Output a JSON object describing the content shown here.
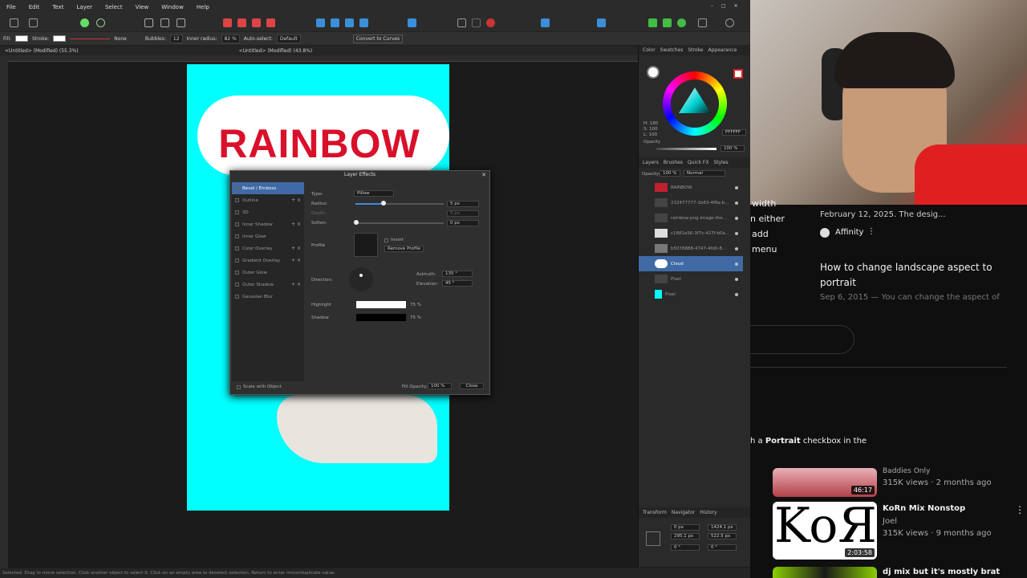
{
  "menu": [
    "File",
    "Edit",
    "Text",
    "Layer",
    "Select",
    "View",
    "Window",
    "Help"
  ],
  "context": {
    "fill_label": "Fill:",
    "stroke_label": "Stroke:",
    "stroke_value": "None",
    "bubbles_label": "Bubbles:",
    "bubbles_value": "12",
    "inner_radius_label": "Inner radius:",
    "inner_radius_value": "82 %",
    "auto_select_label": "Auto-select:",
    "auto_select_value": "Default",
    "convert_label": "Convert to Curves"
  },
  "doc_tabs": [
    "<Untitled> (Modified) (55.3%)",
    "<Untitled> (Modified) (43.8%)"
  ],
  "canvas": {
    "title_text": "RAINBOW"
  },
  "dialog": {
    "title": "Layer Effects",
    "effects": [
      {
        "label": "Bevel / Emboss",
        "selected": true,
        "controls": ""
      },
      {
        "label": "Outline",
        "selected": false,
        "controls": "+ ×"
      },
      {
        "label": "3D",
        "selected": false,
        "controls": ""
      },
      {
        "label": "Inner Shadow",
        "selected": false,
        "controls": "+ ×"
      },
      {
        "label": "Inner Glow",
        "selected": false,
        "controls": ""
      },
      {
        "label": "Color Overlay",
        "selected": false,
        "controls": "+ ×"
      },
      {
        "label": "Gradient Overlay",
        "selected": false,
        "controls": "+ ×"
      },
      {
        "label": "Outer Glow",
        "selected": false,
        "controls": ""
      },
      {
        "label": "Outer Shadow",
        "selected": false,
        "controls": "+ ×"
      },
      {
        "label": "Gaussian Blur",
        "selected": false,
        "controls": ""
      }
    ],
    "type_label": "Type:",
    "type_value": "Pillow",
    "radius_label": "Radius:",
    "radius_value": "5 px",
    "depth_label": "Depth:",
    "depth_value": "5 px",
    "soften_label": "Soften:",
    "soften_value": "0 px",
    "profile_label": "Profile",
    "invert_label": "Invert",
    "remove_profile_label": "Remove Profile",
    "direction_label": "Direction:",
    "azimuth_label": "Azimuth:",
    "azimuth_value": "135 °",
    "elevation_label": "Elevation:",
    "elevation_value": "45 °",
    "highlight_label": "Highlight",
    "highlight_value": "75 %",
    "shadow_label": "Shadow",
    "shadow_value": "75 %",
    "scale_label": "Scale with Object",
    "fill_opacity_label": "Fill Opacity:",
    "fill_opacity_value": "100 %",
    "close_label": "Close"
  },
  "color_panel": {
    "tabs": [
      "Color",
      "Swatches",
      "Stroke",
      "Appearance"
    ],
    "hex": "FFFFFF",
    "opacity_label": "Opacity",
    "opacity_value": "100 %",
    "h": "H: 180",
    "s": "S: 100",
    "l": "L: 100"
  },
  "layers_panel": {
    "tabs": [
      "Layers",
      "Brushes",
      "Quick FX",
      "Styles"
    ],
    "opacity_label": "Opacity:",
    "opacity_value": "100 %",
    "blend": "Normal",
    "layers": [
      {
        "name": "RAINBOW",
        "selected": false,
        "thumb": "#c02030"
      },
      {
        "name": "232477777-1b63-4f8a-b...",
        "selected": false,
        "thumb": "#2a2a2a"
      },
      {
        "name": "rainbow-png-image-the...",
        "selected": false,
        "thumb": "#3a3a3a"
      },
      {
        "name": "c1881e56-3f7c-427f-b0a...",
        "selected": false,
        "thumb": "#dcdcdc"
      },
      {
        "name": "b5078888-4747-4fd0-8...",
        "selected": false,
        "thumb": "#777"
      },
      {
        "name": "Cloud",
        "selected": true,
        "thumb": "#ffffff"
      },
      {
        "name": "Pixel",
        "selected": false,
        "thumb": "#2a2a2a"
      },
      {
        "name": "Pixel",
        "selected": false,
        "thumb": "#00ffff"
      }
    ]
  },
  "transform_panel": {
    "tabs": [
      "Transform",
      "Navigator",
      "History"
    ],
    "x": "0 px",
    "y": "295.1 px",
    "w": "1424.1 px",
    "h": "522.5 px",
    "r": "0 °",
    "s": "0 °"
  },
  "youtube": {
    "partial_left": [
      "width",
      "n either",
      "add",
      "menu"
    ],
    "date1": "February 12, 2025. The desig...",
    "channel1": "Affinity",
    "title2": "How to change landscape aspect to portrait",
    "snippet2": "Sep 6, 2015 — You can change the aspect of",
    "snippet_bottom_prefix": "h a ",
    "snippet_bottom_bold": "Portrait",
    "snippet_bottom_suffix": " checkbox in the",
    "videos": [
      {
        "title": "Baddies Only",
        "meta": "315K views · 2 months ago",
        "duration": "46:17"
      },
      {
        "title": "KoRn Mix Nonstop",
        "channel": "Joel",
        "meta": "315K views · 9 months ago",
        "duration": "2:03:58",
        "thumb_text": "KoЯn"
      },
      {
        "title": "dj mix but it's mostly brat"
      }
    ]
  },
  "status": "Selected. Drag to move selection. Click another object to select it. Click on an empty area to deselect selection. Return to enter move/duplicate value."
}
